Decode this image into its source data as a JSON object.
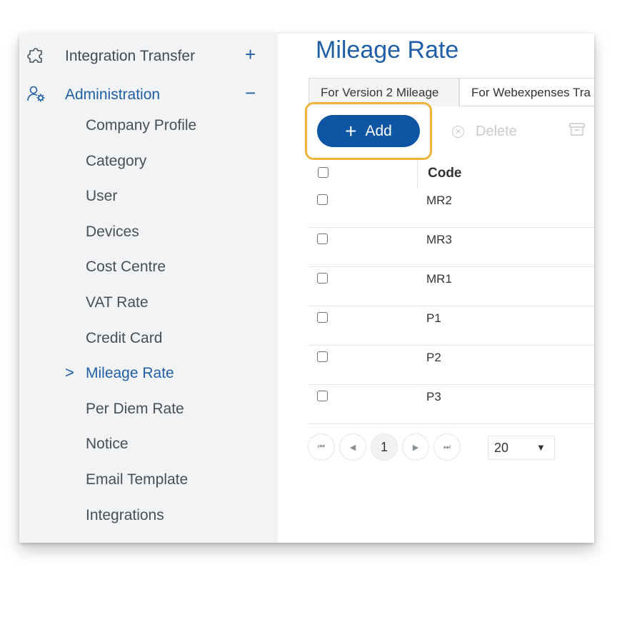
{
  "sidebar": {
    "groups": [
      {
        "label": "Integration Transfer",
        "icon": "puzzle-icon",
        "toggle": "+"
      },
      {
        "label": "Administration",
        "icon": "user-settings-icon",
        "toggle": "−"
      }
    ],
    "items": [
      {
        "label": "Company Profile"
      },
      {
        "label": "Category"
      },
      {
        "label": "User"
      },
      {
        "label": "Devices"
      },
      {
        "label": "Cost Centre"
      },
      {
        "label": "VAT Rate"
      },
      {
        "label": "Credit Card"
      },
      {
        "label": "Mileage Rate",
        "active": true
      },
      {
        "label": "Per Diem Rate"
      },
      {
        "label": "Notice"
      },
      {
        "label": "Email Template"
      },
      {
        "label": "Integrations"
      }
    ],
    "active_chevron": ">"
  },
  "main": {
    "title": "Mileage Rate",
    "tabs": [
      {
        "label": "For Version 2 Mileage",
        "active": true
      },
      {
        "label": "For Webexpenses Tra"
      }
    ],
    "toolbar": {
      "add_label": "Add",
      "add_icon": "+",
      "delete_label": "Delete"
    },
    "grid": {
      "header": {
        "code": "Code"
      },
      "rows": [
        {
          "code": "MR2"
        },
        {
          "code": "MR3"
        },
        {
          "code": "MR1"
        },
        {
          "code": "P1"
        },
        {
          "code": "P2"
        },
        {
          "code": "P3"
        }
      ]
    },
    "pager": {
      "current_page": "1",
      "page_size": "20"
    }
  },
  "colors": {
    "accent": "#1f5fa6",
    "button": "#0e56a3",
    "highlight": "#f0b43c",
    "sidebar_bg": "#f1f3f5"
  }
}
